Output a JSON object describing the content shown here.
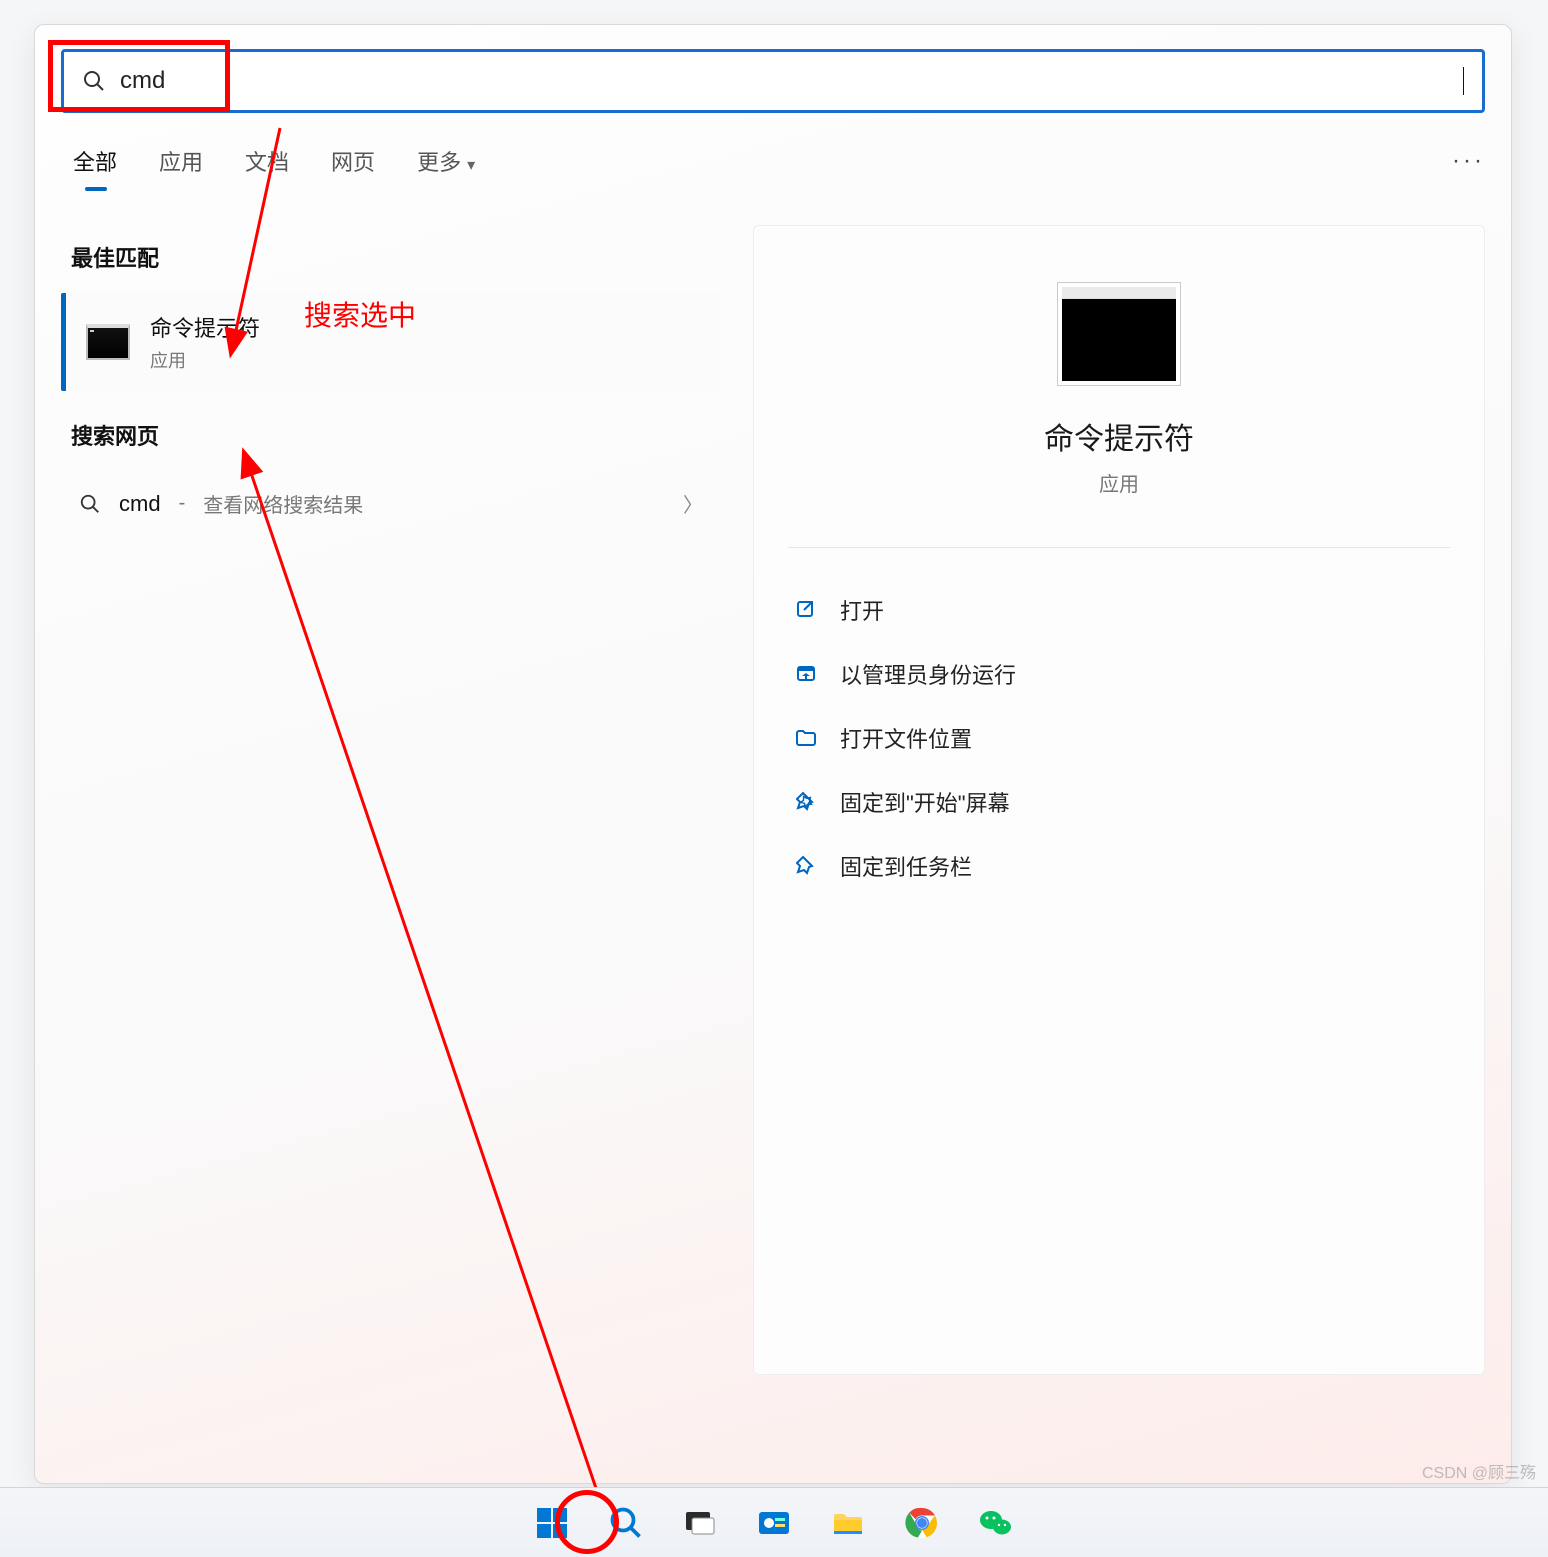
{
  "search": {
    "query": "cmd"
  },
  "tabs": {
    "all": "全部",
    "apps": "应用",
    "docs": "文档",
    "web": "网页",
    "more": "更多"
  },
  "sections": {
    "best_match": "最佳匹配",
    "search_web": "搜索网页"
  },
  "best_match": {
    "title": "命令提示符",
    "subtitle": "应用"
  },
  "web_result": {
    "query": "cmd",
    "separator": " - ",
    "desc": "查看网络搜索结果"
  },
  "preview": {
    "title": "命令提示符",
    "subtitle": "应用"
  },
  "actions": {
    "open": "打开",
    "run_admin": "以管理员身份运行",
    "open_location": "打开文件位置",
    "pin_start": "固定到\"开始\"屏幕",
    "pin_taskbar": "固定到任务栏"
  },
  "annotation": {
    "search_selected": "搜索选中"
  },
  "watermark": "CSDN @顾三殇",
  "taskbar_icons": {
    "start": "start-icon",
    "search": "search-icon",
    "taskview": "taskview-icon",
    "settings": "settings-icon",
    "explorer": "explorer-icon",
    "chrome": "chrome-icon",
    "wechat": "wechat-icon"
  },
  "colors": {
    "accent": "#0067c0",
    "search_border": "#1a6dd0",
    "annotation_red": "#ff0000"
  }
}
